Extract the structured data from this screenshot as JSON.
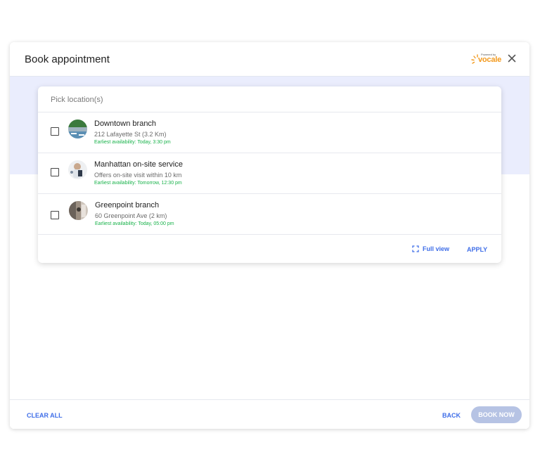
{
  "modal": {
    "title": "Book appointment",
    "brand": {
      "powered_by": "Powered by",
      "name": "vocale"
    }
  },
  "picker": {
    "label": "Pick location(s)",
    "locations": [
      {
        "name": "Downtown branch",
        "address": "212 Lafayette St (3.2 Km)",
        "availability": "Earliest availability: Today, 3:30 pm",
        "checked": false
      },
      {
        "name": "Manhattan on-site service",
        "address": "Offers on-site visit within 10 km",
        "availability": "Earliest availability: Tomorrow, 12:30 pm",
        "checked": false
      },
      {
        "name": "Greenpoint branch",
        "address": "60 Greenpoint Ave (2 km)",
        "availability": "Earliest availability: Today, 05:00 pm",
        "checked": false
      }
    ],
    "full_view_label": "Full view",
    "apply_label": "APPLY"
  },
  "footer": {
    "clear_all_label": "CLEAR ALL",
    "back_label": "BACK",
    "book_now_label": "BOOK NOW"
  },
  "colors": {
    "accent": "#3f6ee8",
    "availability_green": "#18b24a",
    "band": "#eaedfd",
    "book_now_disabled": "#b6c3e4",
    "brand_orange": "#f39a1e"
  },
  "icons": {
    "close": "close-icon",
    "full_view": "expand-icon",
    "brand_sun": "sun-rays-icon"
  }
}
